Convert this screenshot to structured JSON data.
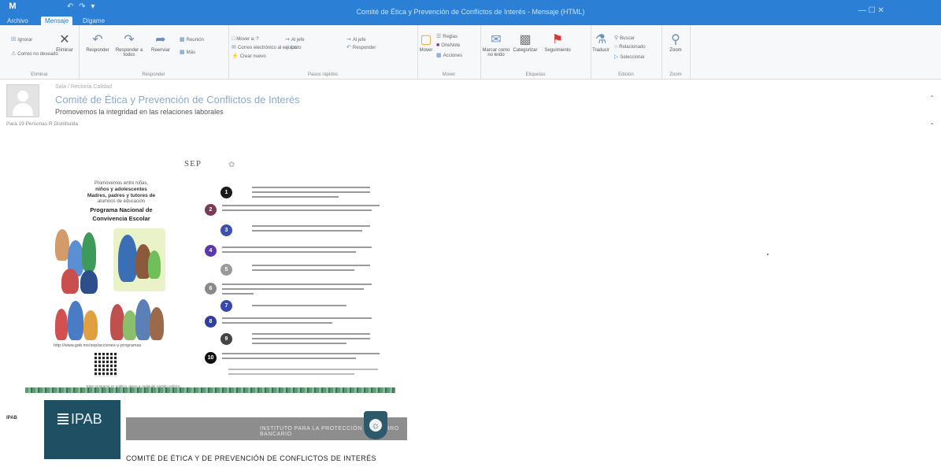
{
  "titlebar": {
    "app_icon": "outlook-icon",
    "app_letter": "M",
    "quick_access": "↶ ↷ ▾",
    "window_title": "Comité de Ética y Prevención de Conflictos de Interés - Mensaje (HTML)",
    "controls": "—  ☐  ✕",
    "tabs": [
      "Archivo",
      "Mensaje",
      "Dígame qué desea hacer"
    ]
  },
  "ribbon": {
    "ignore": "Ignorar",
    "junk": "Correo no deseado",
    "delete": "Eliminar",
    "reply": "Responder",
    "reply_all": "Responder a todos",
    "forward": "Reenviar",
    "meeting": "Reunión",
    "more": "Más",
    "quick_steps": [
      "Mover a: ?",
      "Al jefe",
      "Correo electrónico al equipo",
      "Listo",
      "Crear nuevo"
    ],
    "move": "Mover",
    "rules": "Reglas",
    "onenote": "OneNote",
    "actions": "Acciones",
    "mark_unread": "Marcar como no leído",
    "categorize": "Categorizar",
    "follow_up": "Seguimiento",
    "translate": "Traducir",
    "find": "Buscar",
    "related": "Relacionado",
    "select": "Seleccionar",
    "zoom": "Zoom",
    "groups": [
      "Eliminar",
      "Responder",
      "Pasos rápidos",
      "Mover",
      "Etiquetas",
      "Edición",
      "Zoom"
    ]
  },
  "message": {
    "sender": "Sala / Rectoría Calidad",
    "subject": "Comité de Ética y Prevención de Conflictos de Interés",
    "subtitle": "Promovemos la integridad en las relaciones laborales",
    "meta": "Para   19 Personas   R Distribuida"
  },
  "poster": {
    "logo": "SEP",
    "left_lines": [
      "Promovemos entre niñas,",
      "niños y adolescentes"
    ],
    "left_bold": [
      "Madres, padres y tutores de",
      "alumnos de educación"
    ],
    "program_title": [
      "Programa Nacional de",
      "Convivencia Escolar"
    ],
    "url": "http://www.gob.mx/sep/acciones-y-programas",
    "numbers": [
      "1",
      "2",
      "3",
      "4",
      "5",
      "6",
      "7",
      "8",
      "9",
      "10"
    ],
    "number_colors": [
      "#1a1a1a",
      "#7a3b56",
      "#3b4fb0",
      "#5a3aa8",
      "#9a9a9a",
      "#8a8a8a",
      "#3949ab",
      "#2e3f9e",
      "#444444",
      "#111111"
    ],
    "footer": "Este programa es público, ajeno a cualquier partido político."
  },
  "banner": {
    "left_text": "IPAB",
    "logo": "IPAB",
    "band_text": "INSTITUTO PARA LA PROTECCIÓN AL AHORRO BANCARIO",
    "comite": "COMITÉ DE ÉTICA Y DE PREVENCIÓN DE CONFLICTOS DE INTERÉS"
  }
}
